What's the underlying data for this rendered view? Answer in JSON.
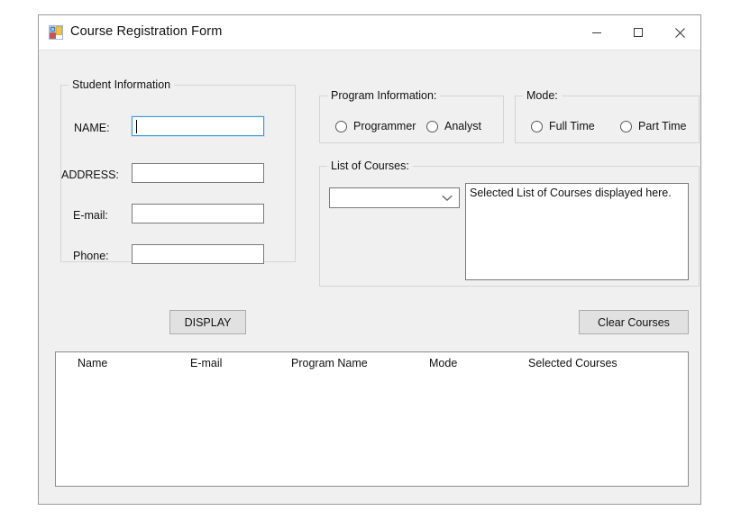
{
  "window": {
    "title": "Course Registration Form",
    "icon": "winforms-designer-icon",
    "controls": {
      "minimize": "minimize-icon",
      "maximize": "maximize-icon",
      "close": "close-icon"
    }
  },
  "student_information": {
    "legend": "Student Information",
    "fields": [
      {
        "label": "NAME:",
        "value": "",
        "focused": true
      },
      {
        "label": "ADDRESS:",
        "value": "",
        "focused": false
      },
      {
        "label": "E-mail:",
        "value": "",
        "focused": false
      },
      {
        "label": "Phone:",
        "value": "",
        "focused": false
      }
    ]
  },
  "program_information": {
    "legend": "Program Information:",
    "options": [
      {
        "label": "Programmer",
        "selected": false
      },
      {
        "label": "Analyst",
        "selected": false
      }
    ]
  },
  "mode": {
    "legend": "Mode:",
    "options": [
      {
        "label": "Full Time",
        "selected": false
      },
      {
        "label": "Part Time",
        "selected": false
      }
    ]
  },
  "list_of_courses": {
    "legend": "List of Courses:",
    "dropdown": {
      "value": "",
      "placeholder": "",
      "arrow_icon": "chevron-down-icon"
    },
    "selected_courses_text": "Selected List of Courses displayed here."
  },
  "actions": {
    "display_label": "DISPLAY",
    "clear_courses_label": "Clear Courses"
  },
  "results_grid": {
    "columns": [
      "Name",
      "E-mail",
      "Program Name",
      "Mode",
      "Selected Courses"
    ],
    "rows": []
  },
  "colors": {
    "form_background": "#f0f0f0",
    "focus_border": "#3c99d4",
    "button_face": "#e1e1e1",
    "group_border": "#d5d5d5",
    "field_border": "#7a7a7a"
  }
}
